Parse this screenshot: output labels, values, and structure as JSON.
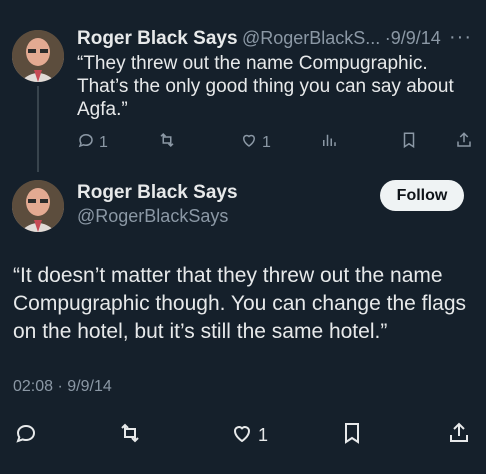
{
  "reply": {
    "author_name": "Roger Black Says",
    "handle": "@RogerBlackS...",
    "separator": "·",
    "date": "9/9/14",
    "more_label": "···",
    "text": "“They threw out the name Compugraphic. That’s the only good thing you can say about Agfa.”",
    "actions": {
      "reply_count": "1",
      "repost_count": "",
      "like_count": "1"
    },
    "icons": [
      "reply-icon",
      "repost-icon",
      "like-icon",
      "views-icon",
      "bookmark-icon",
      "share-icon"
    ]
  },
  "main": {
    "author_name": "Roger Black Says",
    "handle": "@RogerBlackSays",
    "follow_label": "Follow",
    "text": "“It doesn’t matter that they threw out the name Compugraphic though. You can change the flags on the hotel, but it’s still the same hotel.”",
    "timestamp": "02:08 · 9/9/14",
    "actions": {
      "reply_count": "",
      "repost_count": "",
      "like_count": "1"
    }
  },
  "colors": {
    "background": "#15202b",
    "text": "#e7e9ea",
    "muted": "#8b98a5",
    "follow_bg": "#eff3f4"
  }
}
